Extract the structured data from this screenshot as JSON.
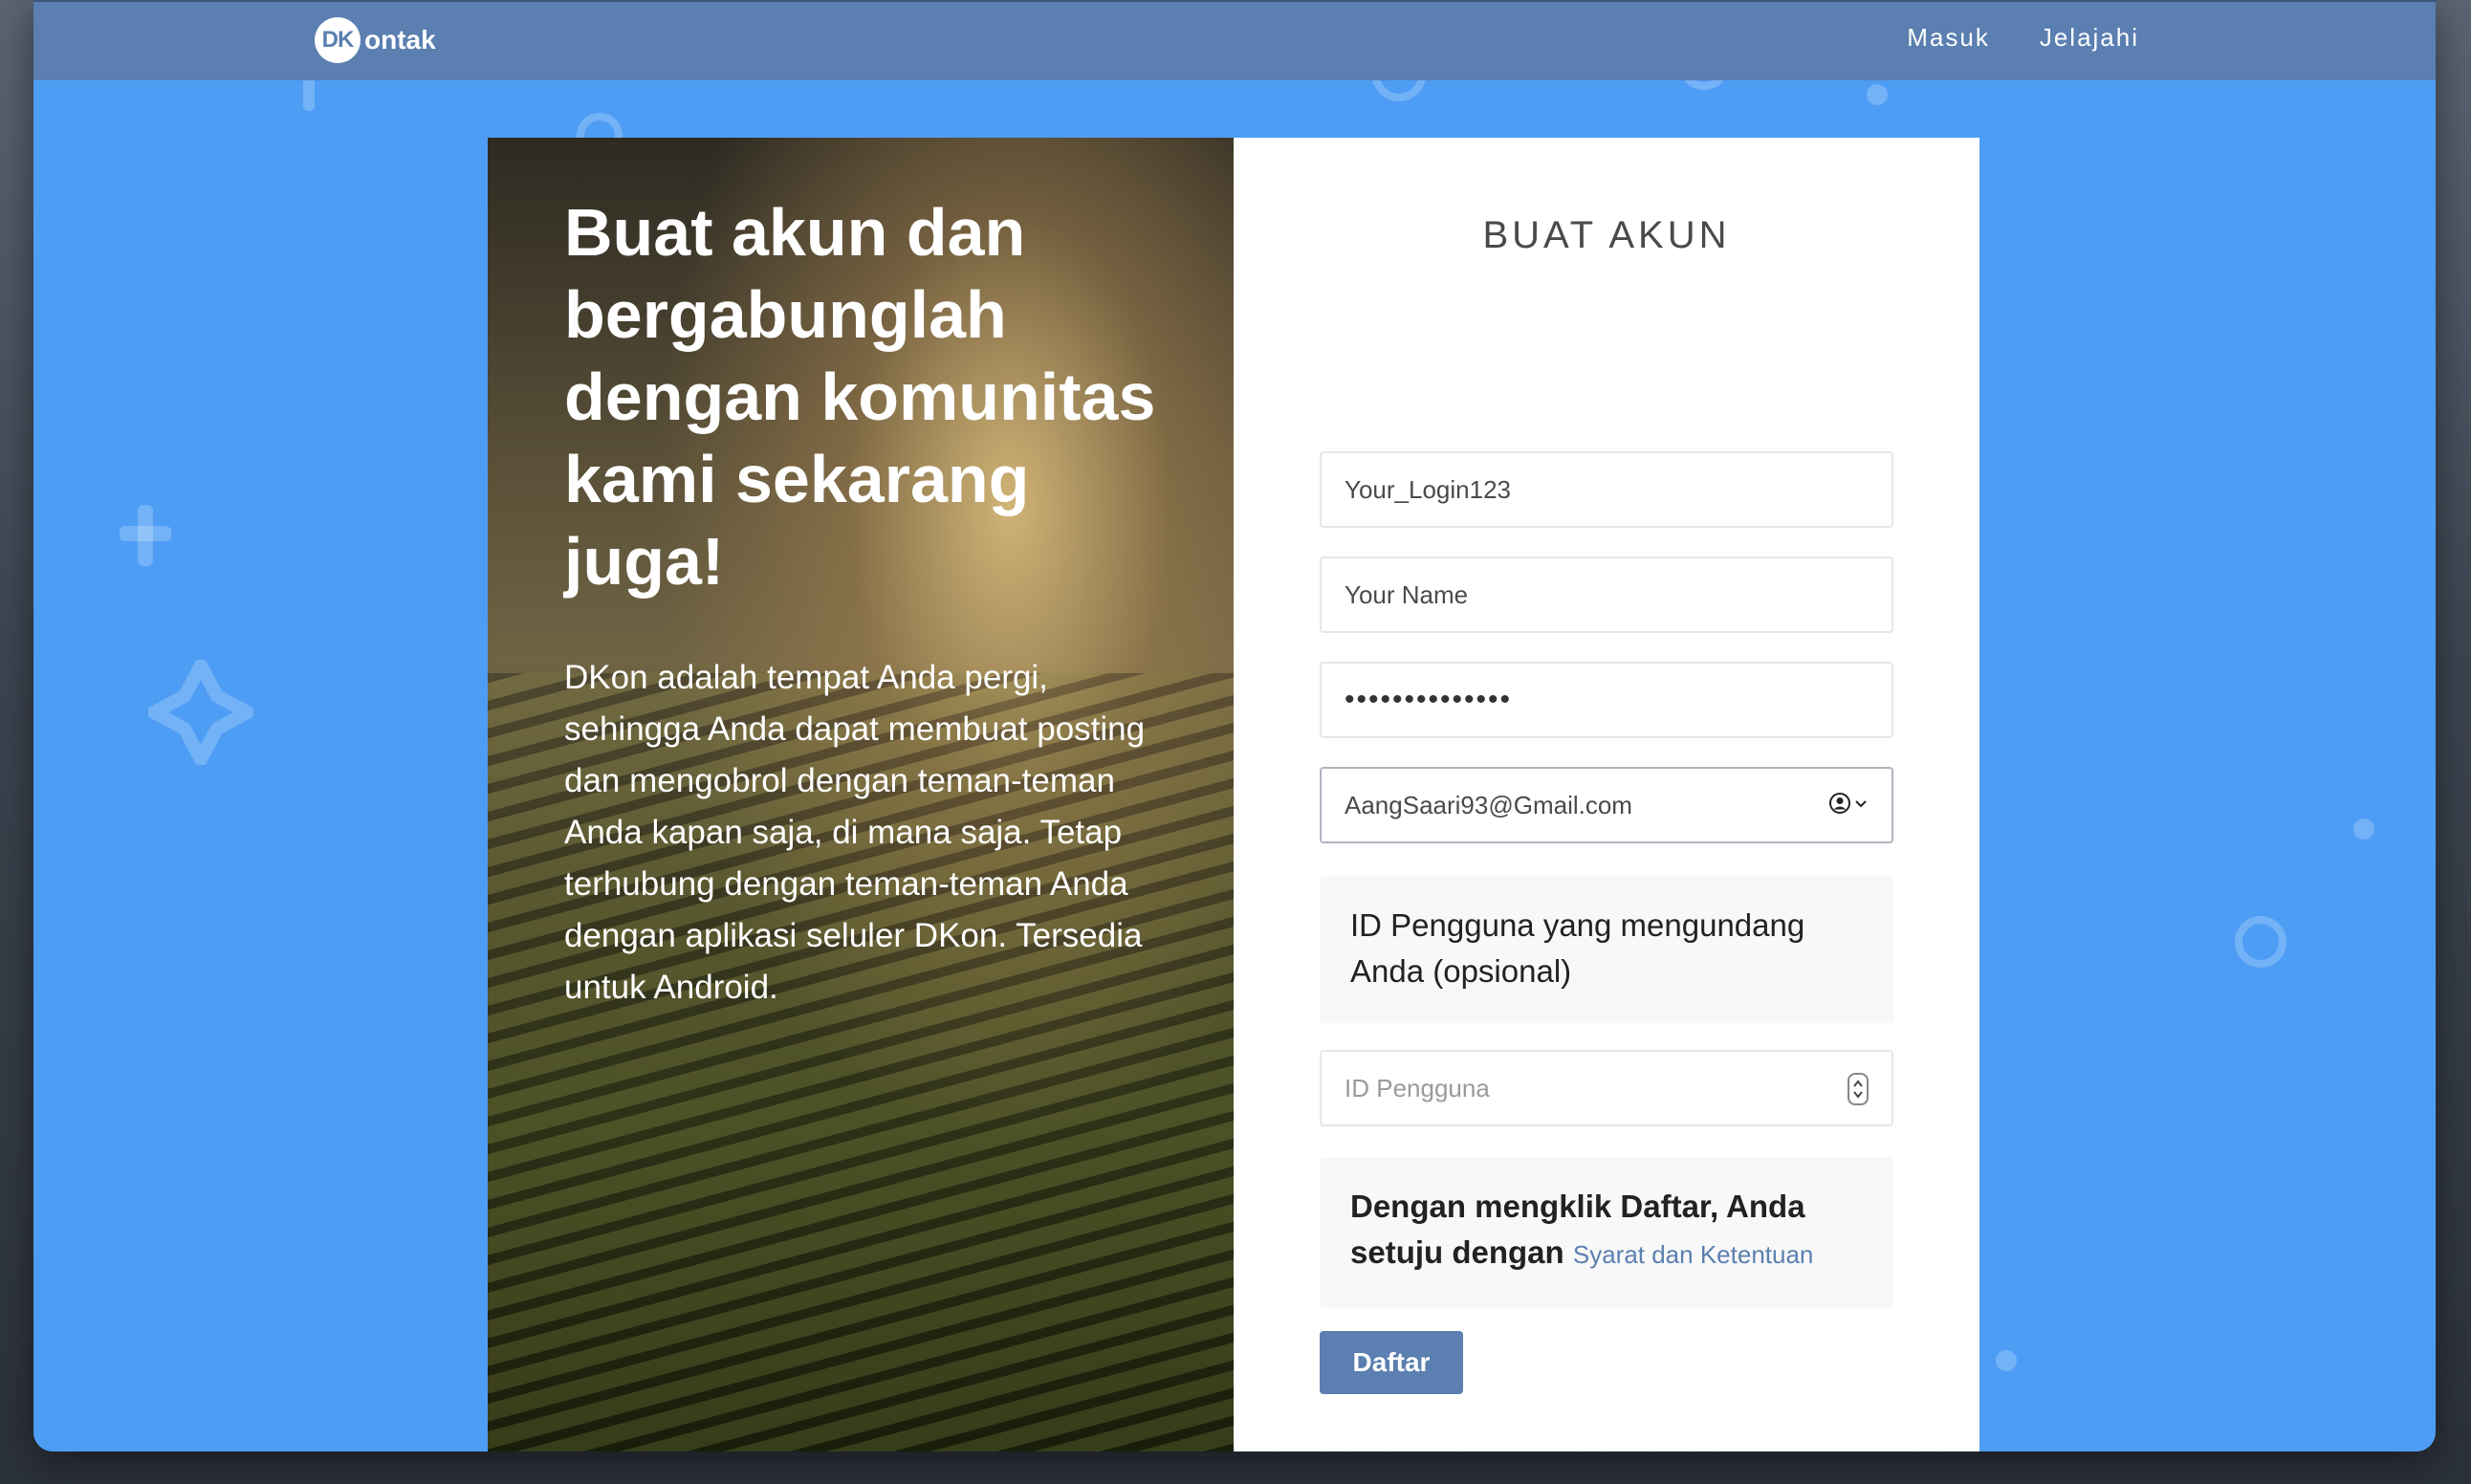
{
  "brand": {
    "badge": "DK",
    "name": "ontak"
  },
  "nav": {
    "masuk": "Masuk",
    "jelajahi": "Jelajahi"
  },
  "hero": {
    "headline": "Buat akun dan bergabunglah dengan komunitas kami sekarang juga!",
    "description": "DKon adalah tempat Anda pergi, sehingga Anda dapat membuat posting dan mengobrol dengan teman-teman Anda kapan saja, di mana saja. Tetap terhubung dengan teman-teman Anda dengan aplikasi seluler DKon. Tersedia untuk Android."
  },
  "form": {
    "title": "BUAT AKUN",
    "login_value": "Your_Login123",
    "name_value": "Your Name",
    "password_mask": "••••••••••••••",
    "email_value": "AangSaari93@Gmail.com",
    "invite_label": "ID Pengguna yang mengundang Anda (opsional)",
    "user_id_placeholder": "ID Pengguna",
    "terms_text": "Dengan mengklik Daftar, Anda setuju dengan",
    "terms_link": "Syarat dan Ketentuan",
    "submit_label": "Daftar"
  },
  "colors": {
    "page_bg": "#4e9df5",
    "topbar": "#5a7fb0",
    "button": "#5a7fb0"
  },
  "icons": [
    "user-circle-icon",
    "chevron-down-icon",
    "stepper-icon",
    "sparkle-icon",
    "plus-icon"
  ]
}
